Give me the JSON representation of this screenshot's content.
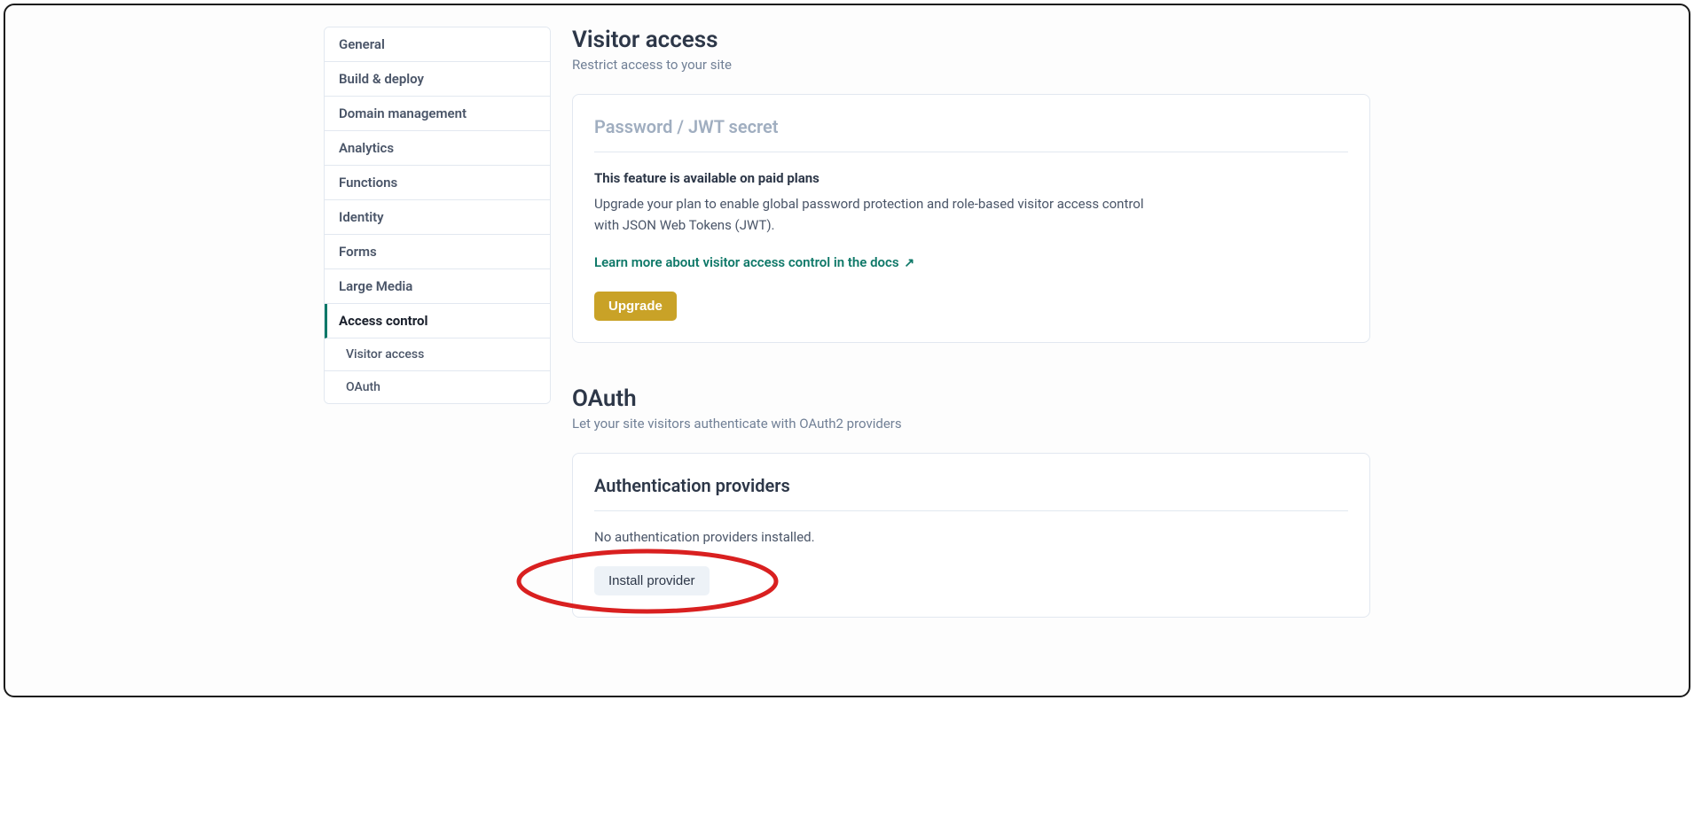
{
  "sidebar": {
    "items": [
      {
        "label": "General"
      },
      {
        "label": "Build & deploy"
      },
      {
        "label": "Domain management"
      },
      {
        "label": "Analytics"
      },
      {
        "label": "Functions"
      },
      {
        "label": "Identity"
      },
      {
        "label": "Forms"
      },
      {
        "label": "Large Media"
      },
      {
        "label": "Access control"
      }
    ],
    "subitems": [
      {
        "label": "Visitor access"
      },
      {
        "label": "OAuth"
      }
    ]
  },
  "visitor_access": {
    "title": "Visitor access",
    "subtitle": "Restrict access to your site",
    "card_heading": "Password / JWT secret",
    "feature_note": "This feature is available on paid plans",
    "feature_desc": "Upgrade your plan to enable global password protection and role-based visitor access control with JSON Web Tokens (JWT).",
    "doc_link": "Learn more about visitor access control in the docs",
    "upgrade_label": "Upgrade"
  },
  "oauth": {
    "title": "OAuth",
    "subtitle": "Let your site visitors authenticate with OAuth2 providers",
    "card_heading": "Authentication providers",
    "empty_text": "No authentication providers installed.",
    "install_label": "Install provider"
  }
}
